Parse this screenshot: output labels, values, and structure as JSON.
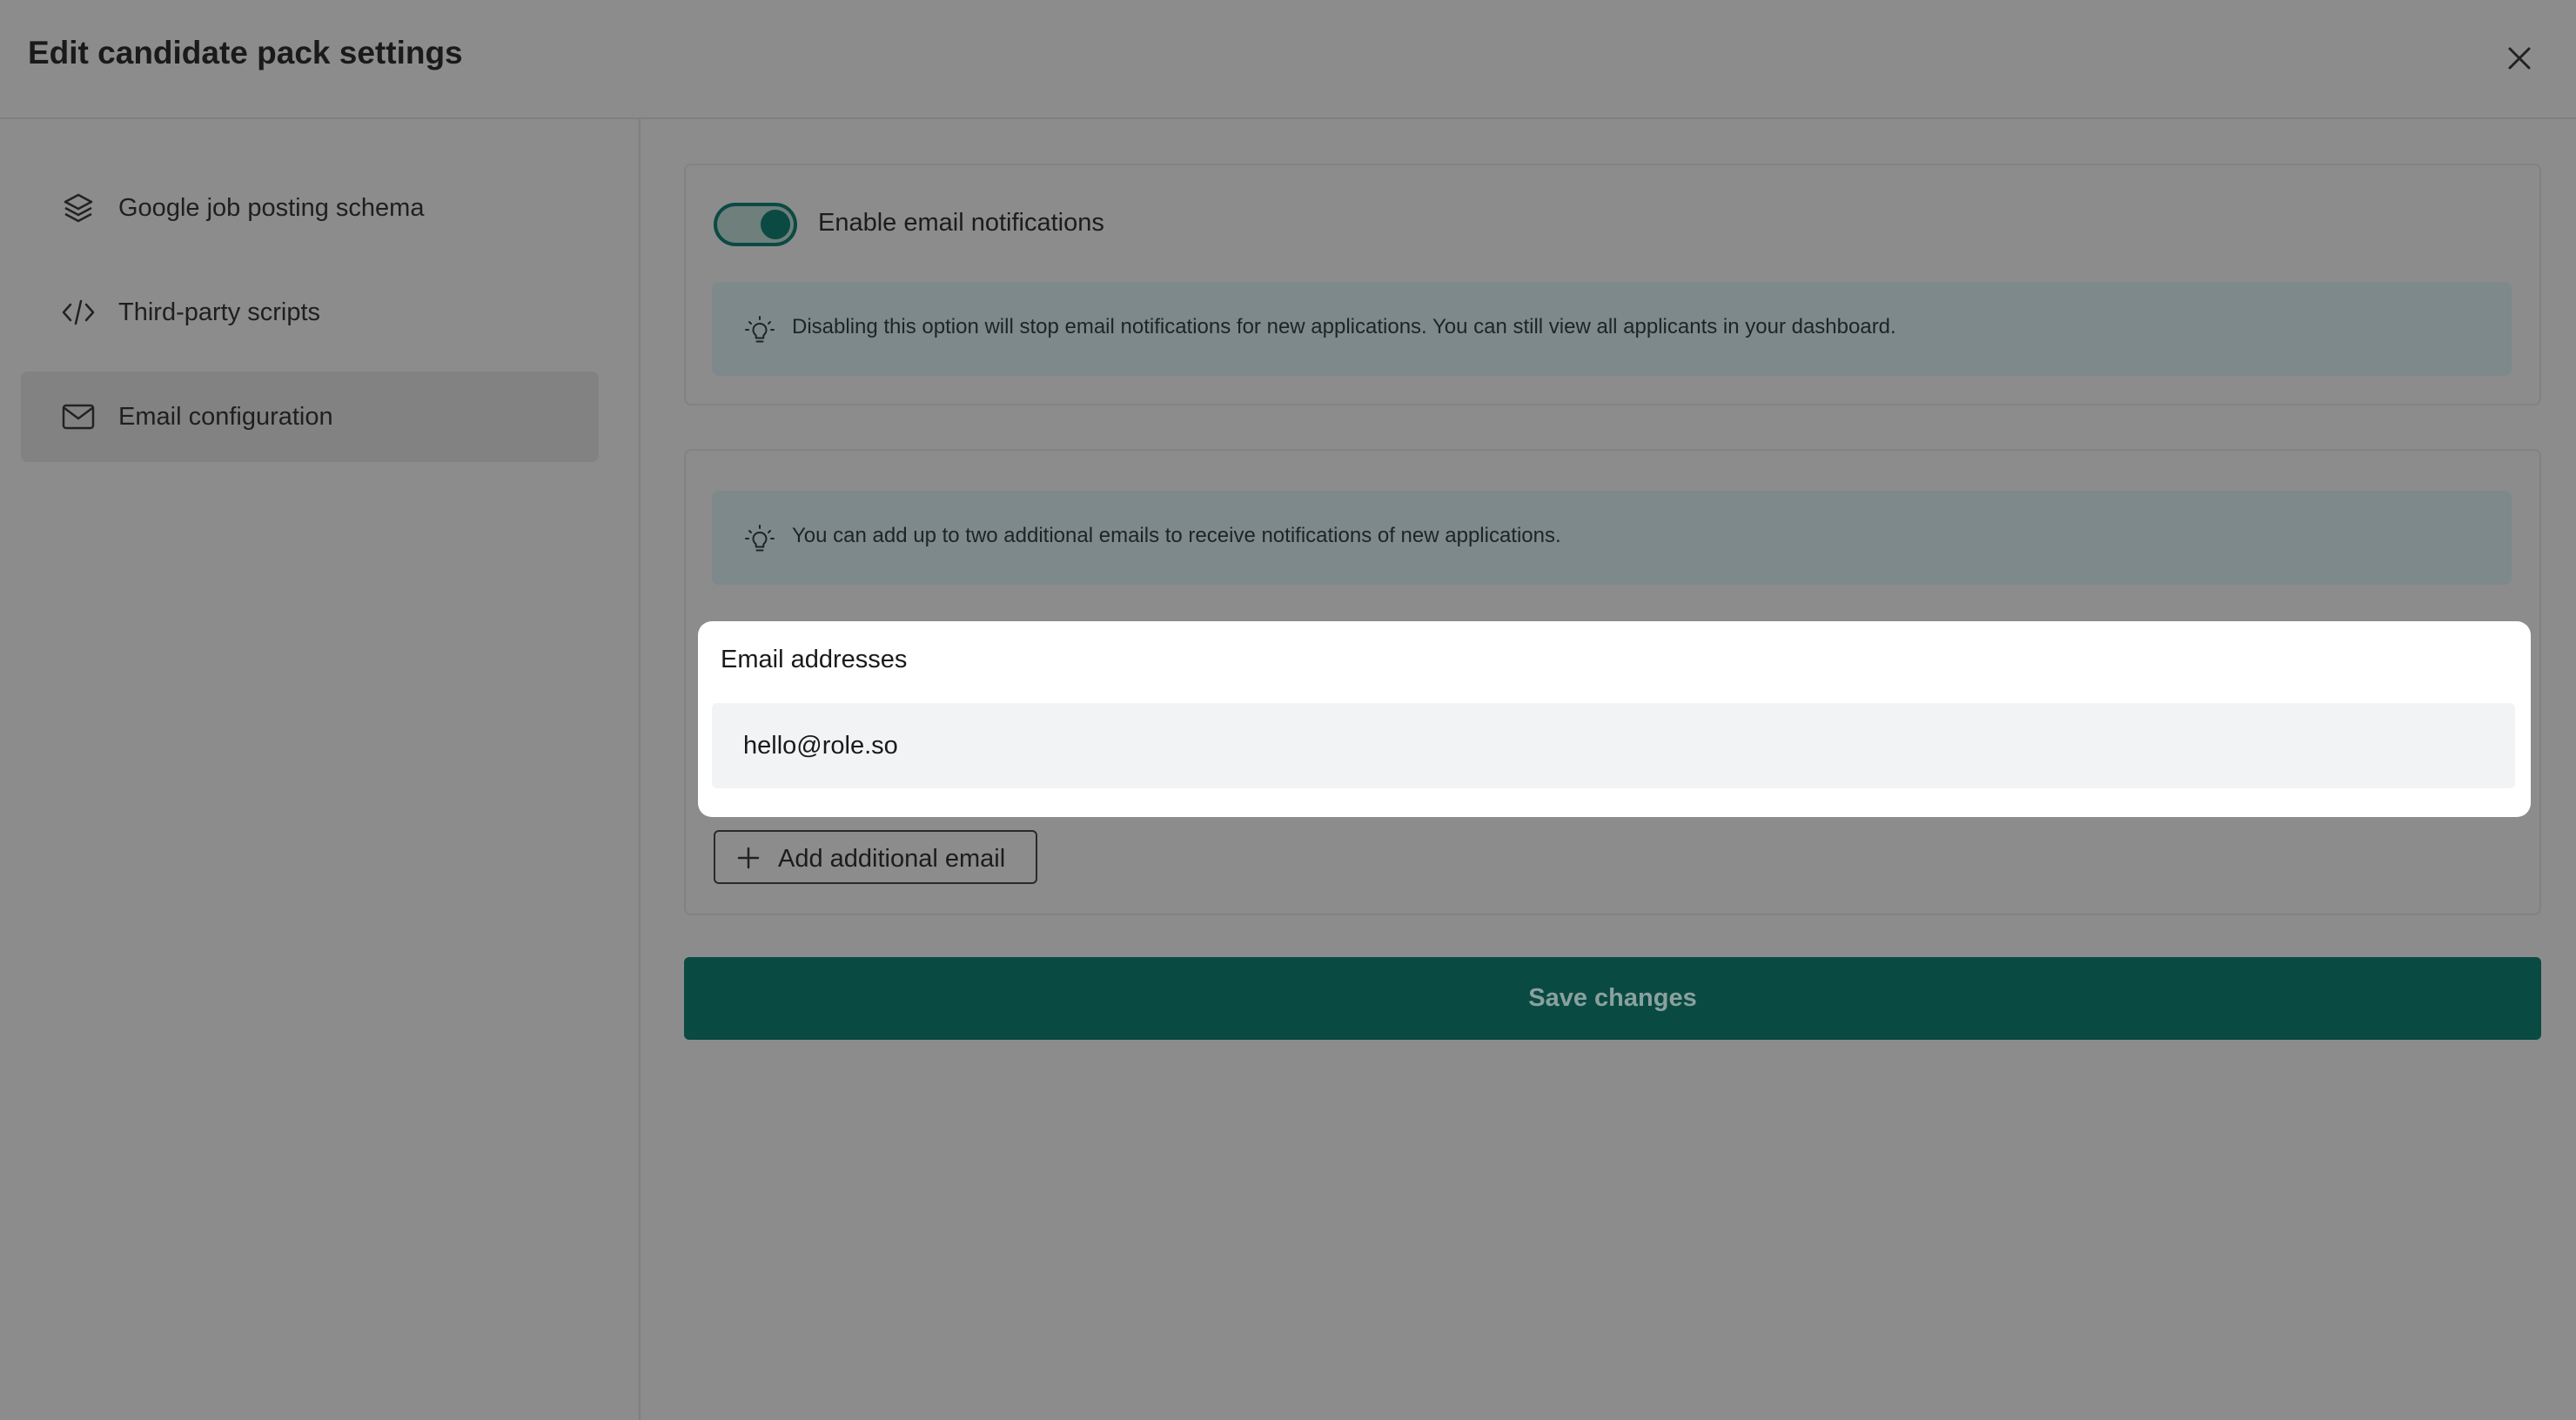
{
  "header": {
    "title": "Edit candidate pack settings",
    "close_icon": "close-icon"
  },
  "sidebar": {
    "items": [
      {
        "label": "Google job posting schema",
        "icon": "layers-icon",
        "active": false
      },
      {
        "label": "Third-party scripts",
        "icon": "code-icon",
        "active": false
      },
      {
        "label": "Email configuration",
        "icon": "mail-icon",
        "active": true
      }
    ]
  },
  "notifications": {
    "toggle_label": "Enable email notifications",
    "enabled": true,
    "info_text": "Disabling this option will stop email notifications for new applications. You can still view all applicants in your dashboard."
  },
  "emails": {
    "info_text": "You can add up to two additional emails to receive notifications of new applications.",
    "panel_label": "Email addresses",
    "primary_email": "hello@role.so",
    "add_button_label": "Add additional email"
  },
  "save_button_label": "Save changes",
  "colors": {
    "accent": "#094a43",
    "info_background": "#7d898a",
    "overlay": "#8c8c8c"
  }
}
